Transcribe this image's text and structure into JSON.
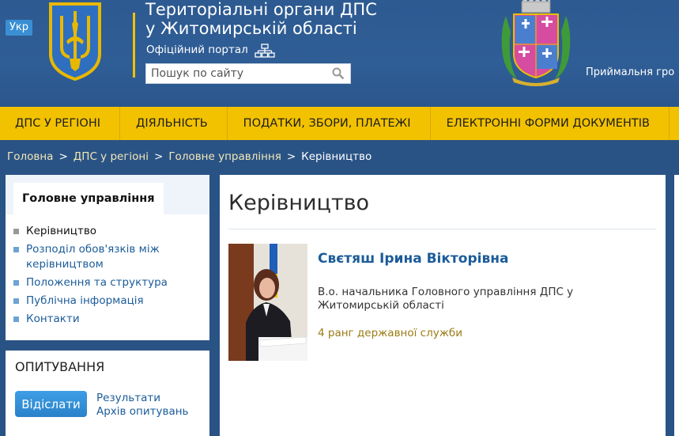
{
  "header": {
    "lang": "Укр",
    "title_line1": "Територіальні органи ДПС",
    "title_line2": "у Житомирській області",
    "portal": "Офіційний портал",
    "search_placeholder": "Пошук по сайту",
    "reception": "Приймальня гро"
  },
  "nav": {
    "items": [
      "ДПС У РЕГІОНІ",
      "ДІЯЛЬНІСТЬ",
      "ПОДАТКИ, ЗБОРИ, ПЛАТЕЖІ",
      "ЕЛЕКТРОННІ ФОРМИ ДОКУМЕНТІВ"
    ]
  },
  "breadcrumb": {
    "items": [
      "Головна",
      "ДПС у регіоні",
      "Головне управління"
    ],
    "current": "Керівництво",
    "separator": ">"
  },
  "sidebar": {
    "tab": "Головне управління",
    "items": [
      {
        "label": "Керівництво",
        "active": true
      },
      {
        "label": "Розподіл обов'язків між керівництвом"
      },
      {
        "label": "Положення та структура"
      },
      {
        "label": "Публічна інформація"
      },
      {
        "label": "Контакти"
      }
    ]
  },
  "poll": {
    "title": "ОПИТУВАННЯ",
    "button": "Відіслати",
    "results": "Результати",
    "archive": "Архів опитувань"
  },
  "main": {
    "title": "Керівництво",
    "person": {
      "name": "Свєтяш Ірина Вікторівна",
      "position": "В.о. начальника Головного управління ДПС у Житомирській області",
      "rank": "4 ранг державної служби"
    }
  },
  "colors": {
    "header_bg": "#2d5a91",
    "nav_bg": "#f2c200",
    "link": "#1b5c99",
    "rank": "#9b7a15",
    "button": "#2a82c9"
  }
}
